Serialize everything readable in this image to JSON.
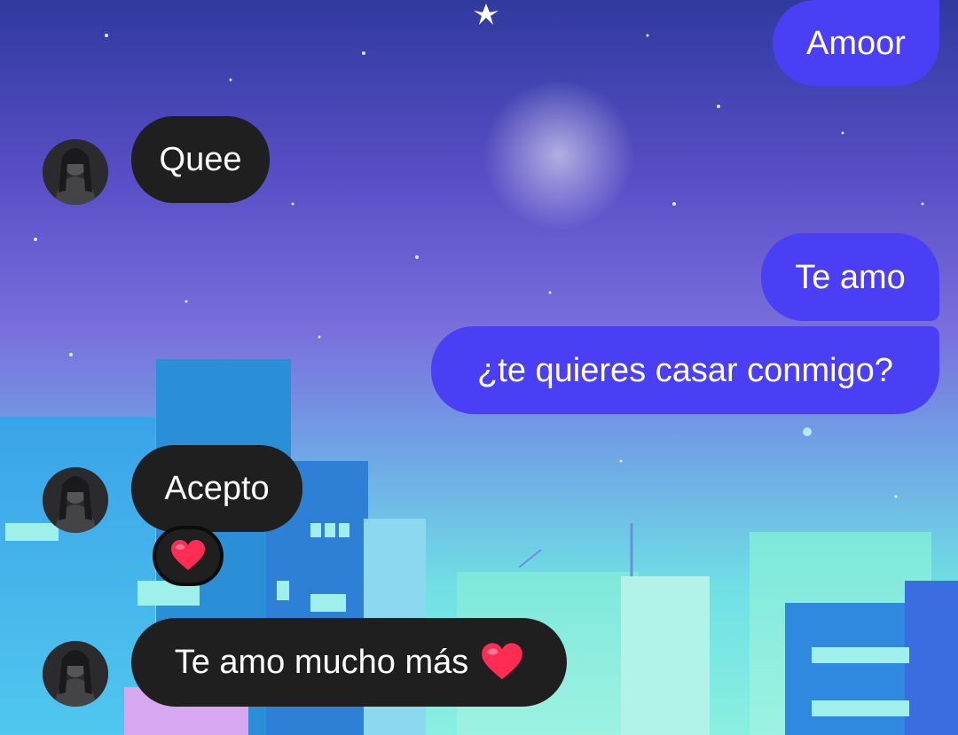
{
  "colors": {
    "outgoing_bubble": "#4a3ff5",
    "incoming_bubble": "#1f1f20",
    "heart": "#ff2d55"
  },
  "background": {
    "scene": "night-city-skyline-with-crescent-moon"
  },
  "chat": {
    "messages": [
      {
        "id": "amoor",
        "direction": "outgoing",
        "text": "Amoor"
      },
      {
        "id": "quee",
        "direction": "incoming",
        "text": "Quee"
      },
      {
        "id": "te-amo",
        "direction": "outgoing",
        "text": "Te amo"
      },
      {
        "id": "casar",
        "direction": "outgoing",
        "text": "¿te quieres casar conmigo?"
      },
      {
        "id": "acepto",
        "direction": "incoming",
        "text": "Acepto",
        "reaction": "heart-icon"
      },
      {
        "id": "mucho-mas",
        "direction": "incoming",
        "text": "Te amo mucho más",
        "trailing_emoji": "heart-icon"
      }
    ]
  }
}
